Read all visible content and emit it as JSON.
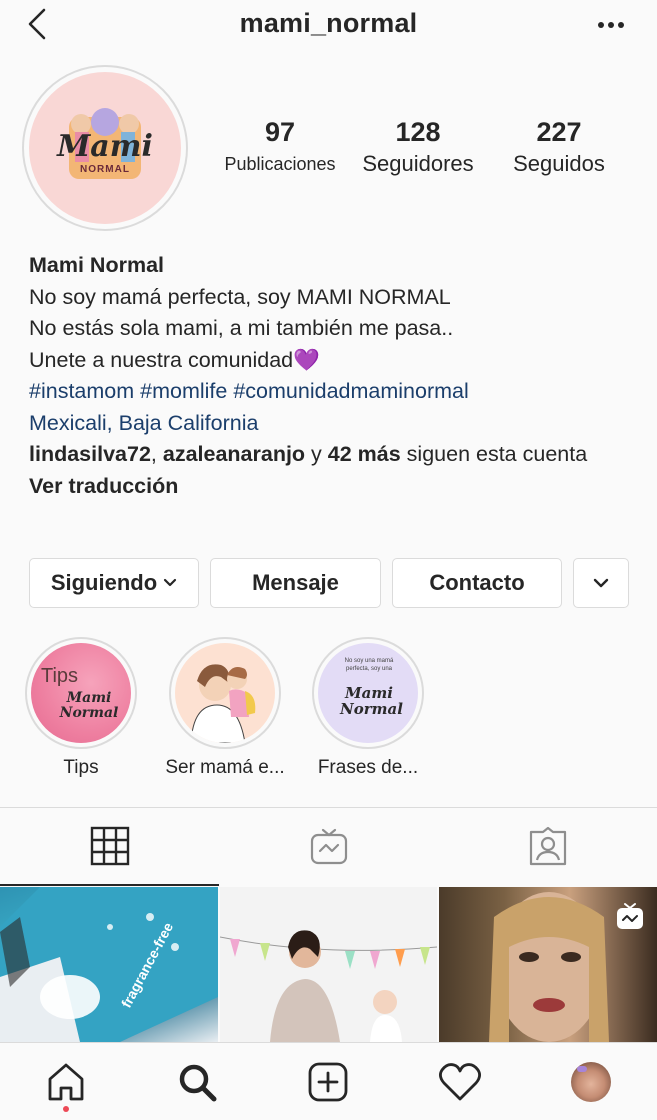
{
  "header": {
    "username": "mami_normal"
  },
  "profile": {
    "logo_text": "Mami",
    "logo_sub": "NORMAL",
    "stats": {
      "posts_count": "97",
      "posts_label": "Publicaciones",
      "followers_count": "128",
      "followers_label": "Seguidores",
      "following_count": "227",
      "following_label": "Seguidos"
    }
  },
  "bio": {
    "name": "Mami Normal",
    "line1": "No soy mamá perfecta, soy MAMI NORMAL",
    "line2": "No estás sola mami, a mi también me pasa..",
    "line3": "Unete a nuestra comunidad💜",
    "hashtag1": "#instamom",
    "hashtag2": "#momlife",
    "hashtag3": "#comunidadmaminormal",
    "location": "Mexicali, Baja California",
    "followed_user1": "lindasilva72",
    "followed_sep": ", ",
    "followed_user2": "azaleanaranjo",
    "followed_y": " y ",
    "followed_more": "42 más",
    "followed_suffix": " siguen esta cuenta",
    "translate": "Ver traducción"
  },
  "actions": {
    "following": "Siguiendo",
    "message": "Mensaje",
    "contact": "Contacto"
  },
  "highlights": [
    {
      "label": "Tips",
      "cover_title": "Tips",
      "cover_logo": "Mami Normal"
    },
    {
      "label": "Ser mamá e..."
    },
    {
      "label": "Frases de...",
      "cover_small": "No soy una mamá perfecta, soy una",
      "cover_logo": "Mami Normal"
    }
  ],
  "grid": {
    "post1_caption": "fragrance-free",
    "igtv_badge_icon": "igtv-icon"
  },
  "colors": {
    "link": "#1b3e6b",
    "border": "#dbdbdb",
    "notification": "#ed4956",
    "avatar_bg": "#f9d7d5"
  }
}
